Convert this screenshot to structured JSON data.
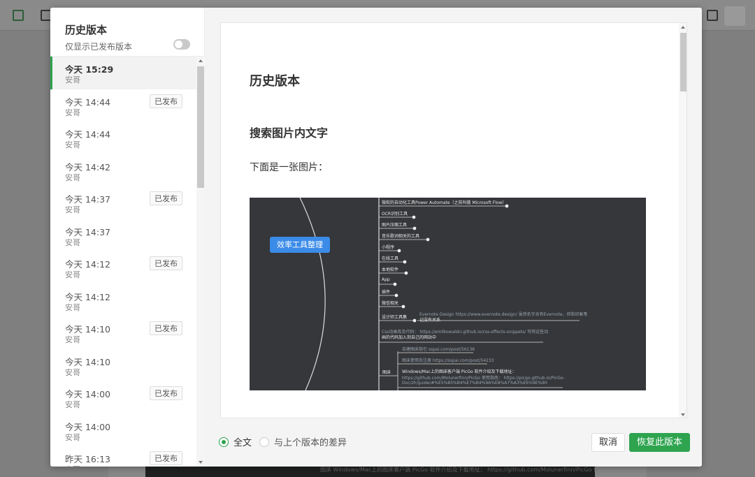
{
  "sidebar": {
    "title": "历史版本",
    "filter_label": "仅显示已发布版本",
    "filter_on": false,
    "versions": [
      {
        "time": "今天 15:29",
        "user": "安哥",
        "badge": "",
        "active": true
      },
      {
        "time": "今天 14:44",
        "user": "安哥",
        "badge": "已发布"
      },
      {
        "time": "今天 14:44",
        "user": "安哥",
        "badge": ""
      },
      {
        "time": "今天 14:42",
        "user": "安哥",
        "badge": ""
      },
      {
        "time": "今天 14:37",
        "user": "安哥",
        "badge": "已发布"
      },
      {
        "time": "今天 14:37",
        "user": "安哥",
        "badge": ""
      },
      {
        "time": "今天 14:12",
        "user": "安哥",
        "badge": "已发布"
      },
      {
        "time": "今天 14:12",
        "user": "安哥",
        "badge": ""
      },
      {
        "time": "今天 14:10",
        "user": "安哥",
        "badge": "已发布"
      },
      {
        "time": "今天 14:10",
        "user": "安哥",
        "badge": ""
      },
      {
        "time": "今天 14:00",
        "user": "安哥",
        "badge": "已发布"
      },
      {
        "time": "今天 14:00",
        "user": "安哥",
        "badge": ""
      },
      {
        "time": "昨天 16:13",
        "user": "安哥",
        "badge": "已发布"
      }
    ]
  },
  "preview": {
    "heading1": "历史版本",
    "heading2": "搜索图片内文字",
    "paragraph": "下面是一张图片：",
    "mindmap": {
      "root": "效率工具整理",
      "nodes": [
        "微软的自动化工具Power Automate（之前叫做 Microsoft Flow）",
        "OCR识别工具",
        "图片压缩工具",
        "音乐歌词相关的工具",
        "小程序",
        "在线工具",
        "本地软件",
        "App",
        "插件",
        "微信相关",
        "设计师工具集",
        "Evernote Design https://www.evernote.design/ 虽然名字含有Evernote，但和印象笔",
        "记没有关系",
        "Css动画库及代码： https://emilkowalski.github.io/css-effects-snippets/ 可将这些动",
        "画的代码加入到自己的网站中",
        "自建图床指引 sspai.com/post/56136",
        "图床使用及注册 https://sspai.com/post/54233",
        "图床",
        "Windows/Mac上的图床客户端 PicGo 软件介绍及下载地址：",
        "https://github.com/Molunerfinn/PicGo 使用指南： https://picgo.github.io/PicGo-",
        "Doc/zh/guide/#%E5%85%B4%E7%B4%9A%E8%A7%A3%E6%9E%90"
      ]
    }
  },
  "footer": {
    "mode_full": "全文",
    "mode_diff": "与上个版本的差异",
    "selected_mode": "full",
    "cancel_label": "取消",
    "restore_label": "恢复此版本"
  },
  "background": {
    "bottom_text": "图床   Windows/Mac上的图床客户端 PicGo 软件介绍及下载地址：  https://github.com/Molunerfinn/PicGo 使用指南： https://picgo.github.io/PicGo-"
  },
  "colors": {
    "accent": "#2ea44f",
    "root_node": "#3b8be8",
    "mindmap_bg": "#35373a"
  }
}
